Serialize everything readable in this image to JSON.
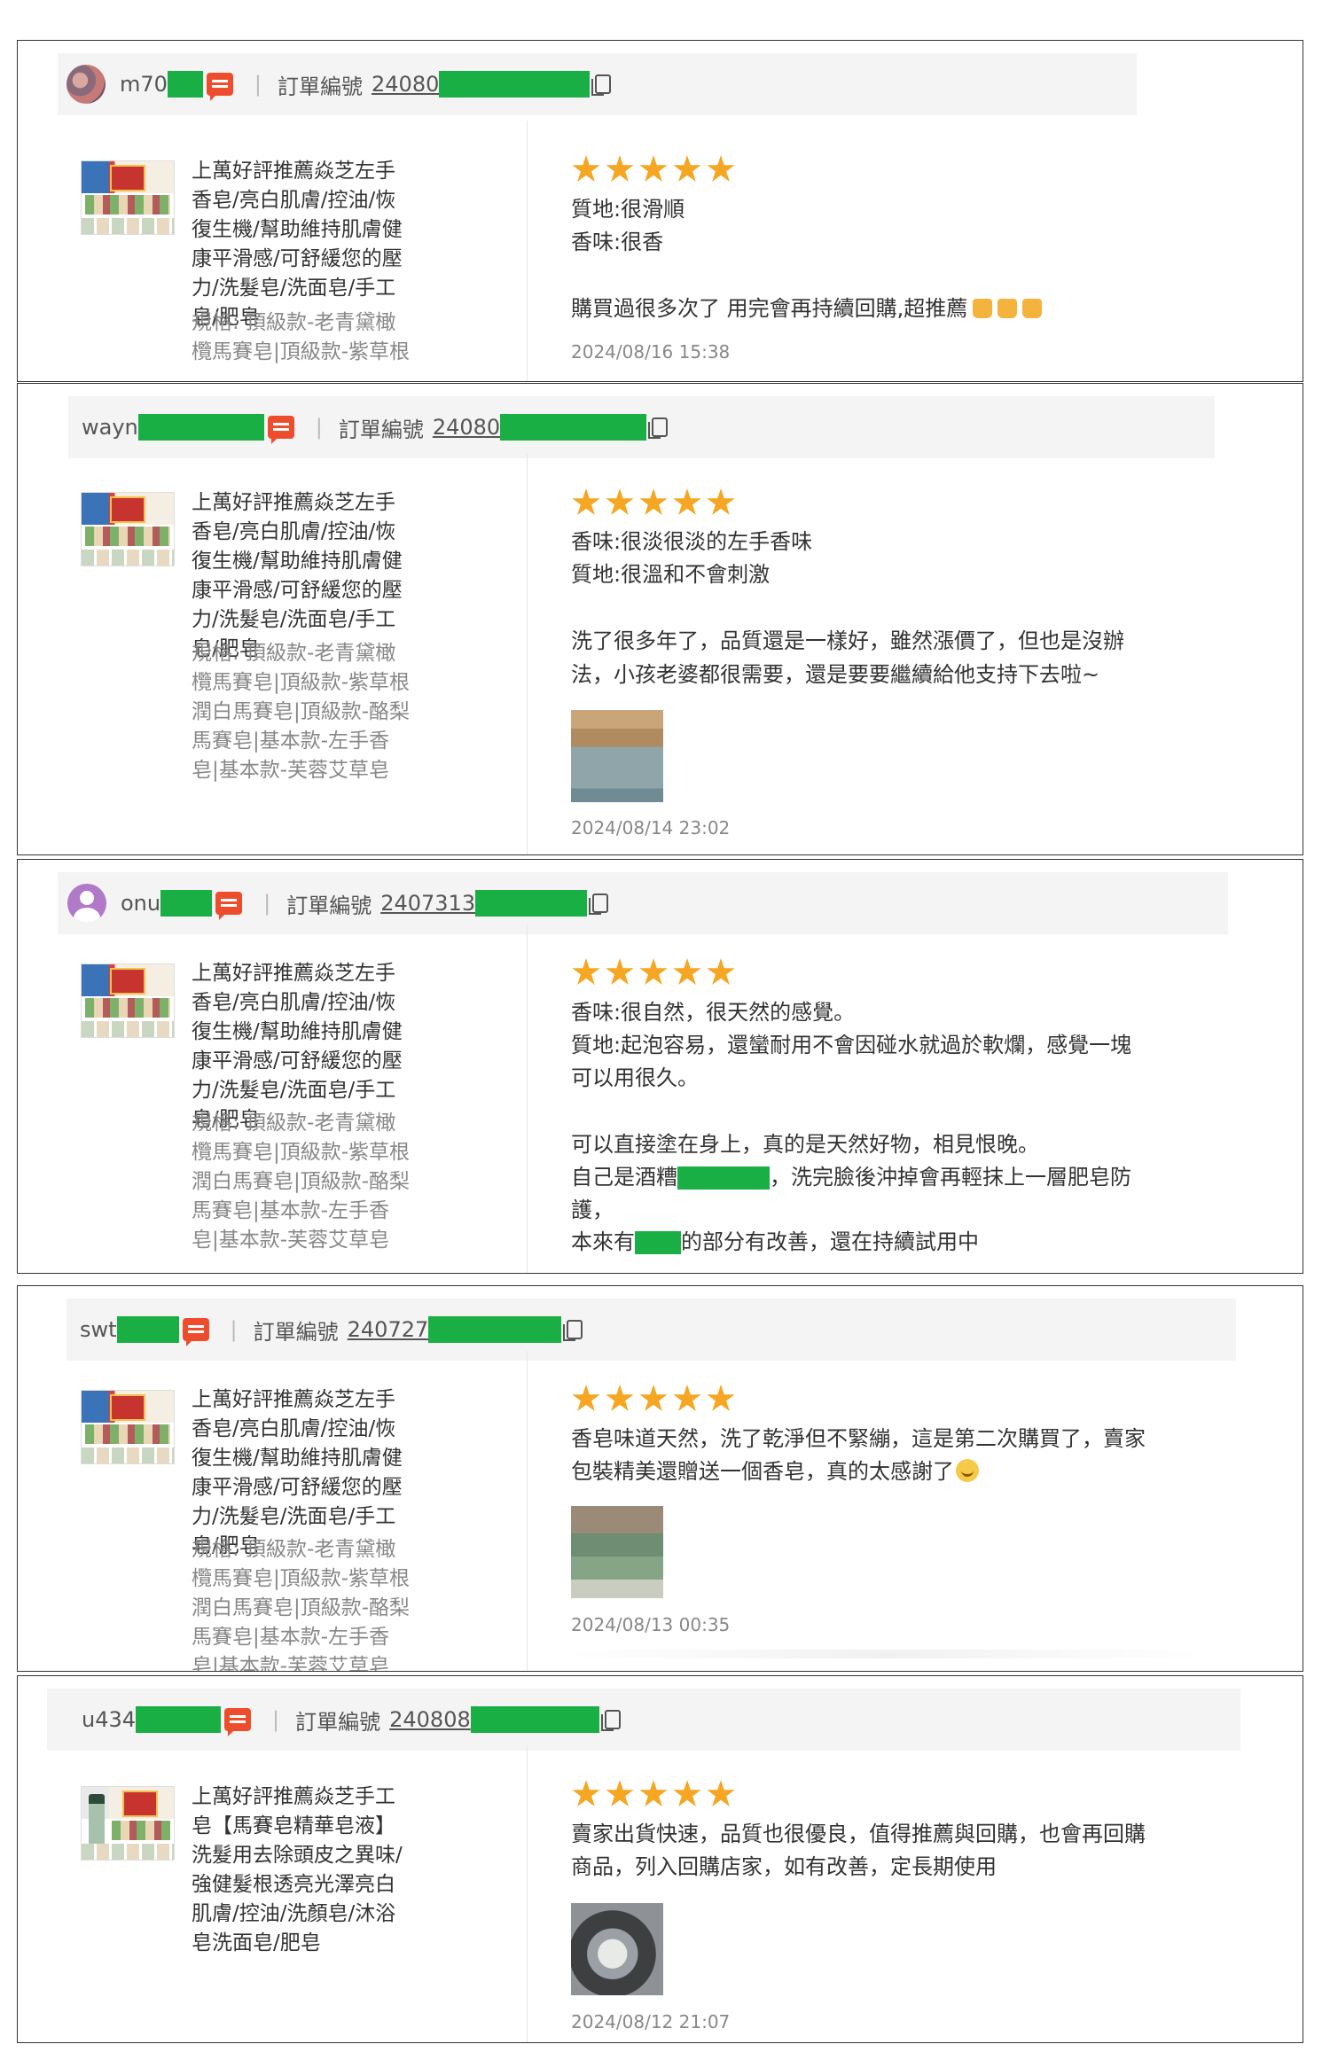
{
  "reviews": [
    {
      "username": "m70",
      "order_label": "訂單編號",
      "order_no": "24080",
      "product_name": "上萬好評推薦焱芝左手香皂/亮白肌膚/控油/恢復生機/幫助維持肌膚健康平滑感/可舒緩您的壓力/洗髮皂/洗面皂/手工皂/肥皂",
      "spec": "規格: 頂級款-老青黛橄欖馬賽皂|頂級款-紫草根潤白馬賽皂|",
      "rating": 5,
      "lines": [
        "質地:很滑順",
        "香味:很香",
        "",
        "購買過很多次了 用完會再持續回購,超推薦"
      ],
      "time": "2024/08/16 15:38"
    },
    {
      "username": "wayn",
      "order_label": "訂單編號",
      "order_no": "24080",
      "product_name": "上萬好評推薦焱芝左手香皂/亮白肌膚/控油/恢復生機/幫助維持肌膚健康平滑感/可舒緩您的壓力/洗髮皂/洗面皂/手工皂/肥皂",
      "spec": "規格: 頂級款-老青黛橄欖馬賽皂|頂級款-紫草根潤白馬賽皂|頂級款-酪梨馬賽皂|基本款-左手香皂|基本款-芙蓉艾草皂",
      "rating": 5,
      "lines": [
        "香味:很淡很淡的左手香味",
        "質地:很溫和不會刺激",
        "",
        "洗了很多年了，品質還是一樣好，雖然漲價了，但也是沒辦",
        "法，小孩老婆都很需要，還是要要繼續給他支持下去啦~"
      ],
      "time": "2024/08/14 23:02"
    },
    {
      "username": "onu",
      "order_label": "訂單編號",
      "order_no": "2407313",
      "product_name": "上萬好評推薦焱芝左手香皂/亮白肌膚/控油/恢復生機/幫助維持肌膚健康平滑感/可舒緩您的壓力/洗髮皂/洗面皂/手工皂/肥皂",
      "spec": "規格: 頂級款-老青黛橄欖馬賽皂|頂級款-紫草根潤白馬賽皂|頂級款-酪梨馬賽皂|基本款-左手香皂|基本款-芙蓉艾草皂",
      "rating": 5,
      "lines": [
        "香味:很自然，很天然的感覺。",
        "質地:起泡容易，還蠻耐用不會因碰水就過於軟爛，感覺一塊",
        "可以用很久。",
        "",
        "可以直接塗在身上，真的是天然好物，相見恨晚。",
        "自己是酒糟",
        "，洗完臉後沖掉會再輕抹上一層肥皂防",
        "護，",
        "本來有",
        "的部分有改善，還在持續試用中"
      ],
      "time": ""
    },
    {
      "username": "swt",
      "order_label": "訂單編號",
      "order_no": "240727",
      "product_name": "上萬好評推薦焱芝左手香皂/亮白肌膚/控油/恢復生機/幫助維持肌膚健康平滑感/可舒緩您的壓力/洗髮皂/洗面皂/手工皂/肥皂",
      "spec": "規格: 頂級款-老青黛橄欖馬賽皂|頂級款-紫草根潤白馬賽皂|頂級款-酪梨馬賽皂|基本款-左手香皂|基本款-芙蓉艾草皂",
      "rating": 5,
      "lines": [
        "香皂味道天然，洗了乾淨但不緊繃，這是第二次購買了，賣家",
        "包裝精美還贈送一個香皂，真的太感謝了"
      ],
      "time": "2024/08/13 00:35"
    },
    {
      "username": "u434",
      "order_label": "訂單編號",
      "order_no": "240808",
      "product_name": "上萬好評推薦焱芝手工皂【馬賽皂精華皂液】洗髮用去除頭皮之異味/強健髮根透亮光澤亮白肌膚/控油/洗顏皂/沐浴皂洗面皂/肥皂",
      "spec": "",
      "rating": 5,
      "lines": [
        "賣家出貨快速，品質也很優良，值得推薦與回購，也會再回購",
        "商品，列入回購店家，如有改善，定長期使用"
      ],
      "time": "2024/08/12 21:07"
    }
  ],
  "colors": {
    "star": "#f5a623",
    "chat": "#ee4d2d",
    "redaction": "#1aaf44"
  }
}
